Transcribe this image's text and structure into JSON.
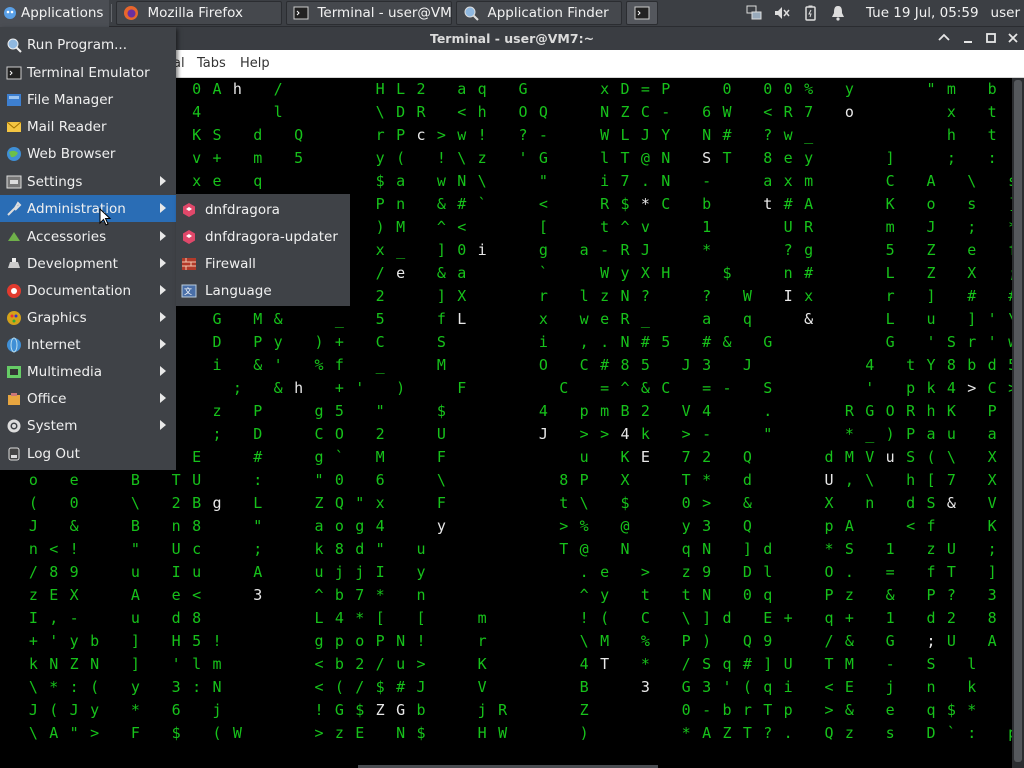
{
  "panel": {
    "applications_label": "Applications",
    "tasks": [
      {
        "label": "Mozilla Firefox",
        "icon": "firefox-icon"
      },
      {
        "label": "Terminal - user@VM...",
        "icon": "terminal-icon"
      },
      {
        "label": "Application Finder",
        "icon": "magnifier-icon"
      }
    ],
    "clock": "Tue 19 Jul, 05:59",
    "user": "user"
  },
  "window": {
    "title": "Terminal - user@VM7:~",
    "menubar": [
      {
        "label": "al"
      },
      {
        "label": "Tabs"
      },
      {
        "label": "Help"
      }
    ]
  },
  "app_menu": {
    "items": [
      {
        "label": "Run Program...",
        "icon": "run-icon",
        "submenu": false
      },
      {
        "label": "Terminal Emulator",
        "icon": "terminal-icon",
        "submenu": false
      },
      {
        "label": "File Manager",
        "icon": "file-manager-icon",
        "submenu": false
      },
      {
        "label": "Mail Reader",
        "icon": "mail-icon",
        "submenu": false
      },
      {
        "label": "Web Browser",
        "icon": "web-browser-icon",
        "submenu": false
      },
      {
        "label": "Settings",
        "icon": "settings-icon",
        "submenu": true
      },
      {
        "label": "Administration",
        "icon": "administration-icon",
        "submenu": true
      },
      {
        "label": "Accessories",
        "icon": "accessories-icon",
        "submenu": true
      },
      {
        "label": "Development",
        "icon": "development-icon",
        "submenu": true
      },
      {
        "label": "Documentation",
        "icon": "documentation-icon",
        "submenu": true
      },
      {
        "label": "Graphics",
        "icon": "graphics-icon",
        "submenu": true
      },
      {
        "label": "Internet",
        "icon": "internet-icon",
        "submenu": true
      },
      {
        "label": "Multimedia",
        "icon": "multimedia-icon",
        "submenu": true
      },
      {
        "label": "Office",
        "icon": "office-icon",
        "submenu": true
      },
      {
        "label": "System",
        "icon": "system-icon",
        "submenu": true
      },
      {
        "label": "Log Out",
        "icon": "logout-icon",
        "submenu": false
      }
    ],
    "submenu": [
      {
        "label": "dnfdragora",
        "icon": "package-icon"
      },
      {
        "label": "dnfdragora-updater",
        "icon": "package-icon"
      },
      {
        "label": "Firewall",
        "icon": "firewall-icon"
      },
      {
        "label": "Language",
        "icon": "language-icon"
      }
    ]
  },
  "terminal_rows": [
    [
      "",
      "",
      "",
      "",
      "",
      "",
      "",
      "",
      "",
      "0",
      "A",
      "h",
      "",
      "/",
      "",
      "",
      "",
      "",
      "H",
      "L",
      "2",
      "",
      "a",
      "q",
      "",
      "G",
      "",
      "",
      "",
      "x",
      "D",
      "=",
      "P",
      "",
      "",
      "0",
      "",
      "0",
      "0",
      "%",
      "",
      "y",
      "",
      "",
      "",
      "\"",
      "m",
      "",
      "b"
    ],
    [
      "",
      "",
      "",
      "",
      "",
      "",
      "",
      "",
      "",
      "4",
      "",
      "",
      "",
      "l",
      "",
      "",
      "",
      "",
      "\\",
      "D",
      "R",
      "",
      "<",
      "h",
      "",
      "O",
      "Q",
      "",
      "",
      "N",
      "Z",
      "C",
      "-",
      "",
      "6",
      "W",
      "",
      "<",
      "R",
      "7",
      "",
      "o",
      "",
      "",
      "",
      "",
      "x",
      "",
      "t"
    ],
    [
      "",
      "",
      "",
      "",
      "",
      "",
      "",
      "",
      "",
      "K",
      "S",
      "",
      "d",
      "",
      "Q",
      "",
      "",
      "",
      "r",
      "P",
      "c",
      ">",
      "w",
      "!",
      "",
      "?",
      "-",
      "",
      "",
      "W",
      "L",
      "J",
      "Y",
      "",
      "N",
      "#",
      "",
      "?",
      "w",
      "_",
      "",
      "",
      "",
      "",
      "",
      "",
      "h",
      "",
      "t"
    ],
    [
      "",
      "",
      "",
      "",
      "",
      "",
      "",
      "",
      "",
      "v",
      "+",
      "",
      "m",
      "",
      "5",
      "",
      "",
      "",
      "y",
      "(",
      "",
      "!",
      "\\",
      "z",
      "",
      "'",
      "G",
      "",
      "",
      "l",
      "T",
      "@",
      "N",
      "",
      "S",
      "T",
      "",
      "8",
      "e",
      "y",
      "",
      "",
      "",
      "]",
      "",
      "",
      ";",
      "",
      ":"
    ],
    [
      "",
      "",
      "",
      "",
      "",
      "",
      "",
      "",
      "",
      "x",
      "e",
      "",
      "q",
      "",
      "",
      "",
      "",
      "",
      "$",
      "a",
      "",
      "w",
      "N",
      "\\",
      "",
      "",
      "\"",
      "",
      "",
      "i",
      "7",
      ".",
      "N",
      "",
      "-",
      "",
      "",
      "a",
      "x",
      "m",
      "",
      "",
      "",
      "C",
      "",
      "A",
      "",
      "\\",
      "",
      "s"
    ],
    [
      "",
      "",
      "",
      "",
      "",
      "",
      "",
      "",
      "",
      "",
      "",
      "",
      "",
      "",
      "",
      "",
      "",
      "",
      "P",
      "n",
      "",
      "&",
      "#",
      "`",
      "",
      "",
      "<",
      "",
      "",
      "R",
      "$",
      "*",
      "C",
      "",
      "b",
      "",
      "",
      "t",
      "#",
      "A",
      "",
      "",
      "",
      "K",
      "",
      "o",
      "",
      "s",
      "",
      "]"
    ],
    [
      "",
      "",
      "",
      "",
      "",
      "",
      "",
      "",
      "",
      "",
      "",
      "",
      "",
      "",
      "",
      "",
      "",
      "",
      ")",
      "M",
      "",
      "^",
      "<",
      "",
      "",
      "",
      "[",
      "",
      "",
      "t",
      "^",
      "v",
      "",
      "",
      "1",
      "",
      "",
      "",
      "U",
      "R",
      "",
      "",
      "",
      "m",
      "",
      "J",
      "",
      ";",
      "",
      "*"
    ],
    [
      "",
      "",
      "",
      "",
      "",
      "",
      "",
      "",
      "",
      "",
      "",
      "",
      "",
      "",
      "",
      "",
      "",
      "",
      "x",
      "_",
      "",
      "]",
      "0",
      "i",
      "",
      "",
      "g",
      "",
      "a",
      "-",
      "R",
      "J",
      "",
      "",
      "*",
      "",
      "",
      "",
      "?",
      "g",
      "",
      "",
      "",
      "5",
      "",
      "Z",
      "",
      "e",
      "",
      "f"
    ],
    [
      "",
      "",
      "",
      "",
      "",
      "",
      "",
      "",
      "",
      "",
      "",
      "",
      "",
      "",
      "",
      "",
      "",
      "",
      "/",
      "e",
      "",
      "&",
      "a",
      "",
      "",
      "",
      "`",
      "",
      "",
      "W",
      "y",
      "X",
      "H",
      "",
      "",
      "$",
      "",
      "",
      "n",
      "#",
      "",
      "",
      "",
      "L",
      "",
      "Z",
      "",
      "X",
      "",
      ";"
    ],
    [
      "",
      "",
      "",
      "",
      "",
      "",
      "",
      "",
      "",
      "",
      "",
      "",
      "",
      "",
      "",
      "",
      "",
      "",
      "2",
      "",
      "",
      "]",
      "X",
      "",
      "",
      "",
      "r",
      "",
      "l",
      "z",
      "N",
      "?",
      "",
      "",
      "?",
      "",
      "W",
      "",
      "I",
      "x",
      "",
      "",
      "",
      "r",
      "",
      "]",
      "",
      "#",
      "",
      "#"
    ],
    [
      "",
      "",
      "",
      "",
      "",
      "",
      "",
      "",
      "",
      "",
      "G",
      "",
      "M",
      "&",
      "",
      "",
      "_",
      "",
      "5",
      "",
      "",
      "f",
      "L",
      "",
      "",
      "",
      "x",
      "",
      "w",
      "e",
      "R",
      "_",
      "",
      "",
      "a",
      "",
      "q",
      "",
      "",
      "&",
      "",
      "",
      "",
      "L",
      "",
      "u",
      "",
      "]",
      "'",
      "\\",
      "x"
    ],
    [
      "",
      "",
      "",
      "",
      "",
      "",
      "",
      "",
      "",
      "",
      "D",
      "",
      "P",
      "y",
      "",
      ")",
      "+",
      "",
      "C",
      "",
      "",
      "S",
      "",
      "",
      "",
      "",
      "i",
      "",
      ",",
      ".",
      "N",
      "#",
      "5",
      "",
      "#",
      "&",
      "",
      "G",
      "",
      "",
      "",
      "",
      "",
      "G",
      "",
      "'",
      "S",
      "r",
      "'",
      "w",
      "T"
    ],
    [
      "",
      "",
      "",
      "",
      "",
      "",
      "",
      "",
      "",
      "",
      "i",
      "",
      "&",
      "'",
      "",
      "%",
      "f",
      "",
      "_",
      "",
      "",
      "M",
      "",
      "",
      "",
      "",
      "O",
      "",
      "C",
      "#",
      "8",
      "5",
      "",
      "J",
      "3",
      "",
      "J",
      "",
      "",
      "",
      "",
      "",
      "4",
      "",
      "t",
      "Y",
      "8",
      "b",
      "d",
      "5"
    ],
    [
      "",
      "",
      "",
      "",
      "",
      "",
      "",
      "",
      "",
      "",
      "",
      ";",
      "",
      "&",
      "h",
      "",
      "+",
      "'",
      "",
      ")",
      "",
      "",
      "F",
      "",
      "",
      "",
      "",
      "C",
      "",
      "=",
      "^",
      "&",
      "C",
      "",
      "=",
      "-",
      "",
      "S",
      "",
      "",
      "",
      "",
      "'",
      "",
      "p",
      "k",
      "4",
      ">",
      "C",
      ">"
    ],
    [
      "",
      "",
      "",
      "",
      "",
      "",
      "",
      "",
      "",
      "",
      "z",
      "",
      "P",
      "",
      "",
      "g",
      "5",
      "",
      "\"",
      "",
      "",
      "$",
      "",
      "",
      "",
      "",
      "4",
      "",
      "p",
      "m",
      "B",
      "2",
      "",
      "V",
      "4",
      "",
      "",
      ".",
      "",
      "",
      "",
      "R",
      "G",
      "O",
      "R",
      "h",
      "K",
      "",
      "P"
    ],
    [
      "",
      "",
      "",
      "",
      "",
      "",
      "",
      "",
      "",
      "",
      ";",
      "",
      "D",
      "",
      "",
      "C",
      "O",
      "",
      "2",
      "",
      "",
      "U",
      "",
      "",
      "",
      "",
      "J",
      "",
      ">",
      ">",
      "4",
      "k",
      "",
      ">",
      "-",
      "",
      "",
      "\"",
      "",
      "",
      "",
      "*",
      "_",
      ")",
      "P",
      "a",
      "u",
      "",
      "a"
    ],
    [
      "",
      "",
      "",
      "",
      "",
      "",
      "",
      "",
      "",
      "E",
      "",
      "",
      "#",
      "",
      "",
      "g",
      "`",
      "",
      "M",
      "",
      "",
      "F",
      "",
      "",
      "",
      "",
      "",
      "",
      "u",
      "",
      "K",
      "E",
      "",
      "7",
      "2",
      "",
      "Q",
      "",
      "",
      "",
      "d",
      "M",
      "V",
      "u",
      "S",
      "(",
      "\\",
      "",
      "X"
    ],
    [
      "",
      "o",
      "",
      "e",
      "",
      "",
      "B",
      "",
      "T",
      "U",
      "",
      "",
      ":",
      "",
      "",
      "\"",
      "0",
      "",
      "6",
      "",
      "",
      "\\",
      "",
      "",
      "",
      "",
      "",
      "8",
      "P",
      "",
      "X",
      "",
      "",
      "T",
      "*",
      "",
      "d",
      "",
      "",
      "",
      "U",
      ",",
      "\\",
      "",
      "h",
      "[",
      "7",
      "",
      "X"
    ],
    [
      "",
      "(",
      "",
      "0",
      "",
      "",
      "\\",
      "",
      "2",
      "B",
      "g",
      "",
      "L",
      "",
      "",
      "Z",
      "Q",
      "\"",
      "x",
      "",
      "",
      "F",
      "",
      "",
      "",
      "",
      "",
      "t",
      "\\",
      "",
      "$",
      "",
      "",
      "0",
      ">",
      "",
      "&",
      "",
      "",
      "",
      "X",
      "",
      "n",
      "",
      "d",
      "S",
      "&",
      "",
      "V"
    ],
    [
      "",
      "J",
      "",
      "&",
      "",
      "",
      "B",
      "",
      "n",
      "8",
      "",
      "",
      "\"",
      "",
      "",
      "a",
      "o",
      "g",
      "4",
      "",
      "",
      "y",
      "",
      "",
      "",
      "",
      "",
      ">",
      "%",
      "",
      "@",
      "",
      "",
      "y",
      "3",
      "",
      "Q",
      "",
      "",
      "",
      "p",
      "A",
      "",
      "",
      "<",
      "f",
      "",
      "",
      "K"
    ],
    [
      "",
      "n",
      "<",
      "!",
      "",
      "",
      "\"",
      "",
      "U",
      "c",
      "",
      "",
      ";",
      "",
      "",
      "k",
      "8",
      "d",
      "\"",
      "",
      "u",
      "",
      "",
      "",
      "",
      "",
      "",
      "T",
      "@",
      "",
      "N",
      "",
      "",
      "q",
      "N",
      "",
      "]",
      "d",
      "",
      "",
      "*",
      "S",
      "",
      "1",
      "",
      "z",
      "U",
      "",
      ";"
    ],
    [
      "",
      "/",
      "8",
      "9",
      "",
      "",
      "u",
      "",
      "I",
      "u",
      "",
      "",
      "A",
      "",
      "",
      "u",
      "j",
      "j",
      "I",
      "",
      "y",
      "",
      "",
      "",
      "",
      "",
      "",
      "",
      ".",
      "e",
      "",
      ">",
      "",
      "z",
      "9",
      "",
      "D",
      "l",
      "",
      "",
      "O",
      ".",
      "",
      "=",
      "",
      "f",
      "T",
      "",
      "]"
    ],
    [
      "",
      "z",
      "E",
      "X",
      "",
      "",
      "A",
      "",
      "e",
      "<",
      "",
      "",
      "3",
      "",
      "",
      "^",
      "b",
      "7",
      "*",
      "",
      "n",
      "",
      "",
      "",
      "",
      "",
      "",
      "",
      "^",
      "y",
      "",
      "t",
      "",
      "t",
      "N",
      "",
      "0",
      "q",
      "",
      "",
      "P",
      "z",
      "",
      "&",
      "",
      "P",
      "?",
      "",
      "3"
    ],
    [
      "",
      "I",
      ",",
      "-",
      "",
      "",
      "u",
      "",
      "d",
      "8",
      "",
      "",
      "",
      "",
      "",
      "L",
      "4",
      "*",
      "[",
      "",
      "[",
      "",
      "",
      "m",
      "",
      "",
      "",
      "",
      "!",
      "(",
      "",
      "C",
      "",
      "\\",
      "]",
      "d",
      "",
      "E",
      "+",
      "",
      "q",
      "+",
      "",
      "1",
      "",
      "d",
      "2",
      "",
      "8"
    ],
    [
      "",
      "+",
      "'",
      "y",
      "b",
      "",
      "]",
      "",
      "H",
      "5",
      "!",
      "",
      "",
      "",
      "",
      "g",
      "p",
      "o",
      "P",
      "N",
      "!",
      "",
      "",
      "r",
      "",
      "",
      "",
      "",
      "\\",
      "M",
      "",
      "%",
      "",
      "P",
      ")",
      "",
      "Q",
      "9",
      "",
      "",
      "/",
      "&",
      "",
      "G",
      "",
      ";",
      "U",
      "",
      "A"
    ],
    [
      "",
      "k",
      "N",
      "Z",
      "N",
      "",
      "]",
      "",
      "'",
      "l",
      "m",
      "",
      "",
      "",
      "",
      "<",
      "b",
      "2",
      "/",
      "u",
      ">",
      "",
      "",
      "K",
      "",
      "",
      "",
      "",
      "4",
      "T",
      "",
      "*",
      "",
      "/",
      "S",
      "q",
      "#",
      "]",
      "U",
      "",
      "T",
      "M",
      "",
      "-",
      "",
      "S",
      "",
      "l"
    ],
    [
      "",
      "\\",
      "*",
      ":",
      "(",
      "",
      "y",
      "",
      "3",
      ":",
      "N",
      "",
      "",
      "",
      "",
      "<",
      "(",
      "/",
      "$",
      "#",
      "J",
      "",
      "",
      "V",
      "",
      "",
      "",
      "",
      "B",
      "",
      "",
      "3",
      "",
      "G",
      "3",
      "'",
      "(",
      "q",
      "i",
      "",
      "<",
      "E",
      "",
      "j",
      "",
      "n",
      "",
      "k"
    ],
    [
      "",
      "J",
      "(",
      "J",
      "y",
      "",
      "*",
      "",
      "6",
      "",
      "j",
      "",
      "",
      "",
      "",
      "!",
      "G",
      "$",
      "Z",
      "G",
      "b",
      "",
      "",
      "j",
      "R",
      "",
      "",
      "",
      "Z",
      "",
      "",
      "",
      "",
      "0",
      "-",
      "b",
      "r",
      "T",
      "p",
      "",
      ">",
      "&",
      "",
      "e",
      "",
      "q",
      "$",
      "*"
    ],
    [
      "",
      "\\",
      "A",
      "\"",
      ">",
      "",
      "F",
      "",
      "$",
      "",
      "(",
      "W",
      "",
      "",
      "",
      ">",
      "z",
      "E",
      "",
      "N",
      "$",
      "",
      "",
      "H",
      "W",
      "",
      "",
      "",
      ")",
      "",
      "",
      "",
      "",
      "*",
      "A",
      "Z",
      "T",
      "?",
      ".",
      "",
      "Q",
      "z",
      "",
      "s",
      "",
      "D",
      "`",
      ":",
      "",
      "p"
    ]
  ],
  "white_chars": [
    "h",
    "o",
    "c",
    "T",
    "q",
    "C",
    "t",
    "i",
    "e",
    "I",
    "L",
    "l",
    "&",
    "u",
    "J",
    "E",
    "g",
    "y",
    "Z",
    "N",
    "U",
    "3"
  ],
  "colors": {
    "terminal_green": "#17c21b",
    "menu_active": "#2a6db5",
    "panel_bg": "#3c3f44"
  }
}
